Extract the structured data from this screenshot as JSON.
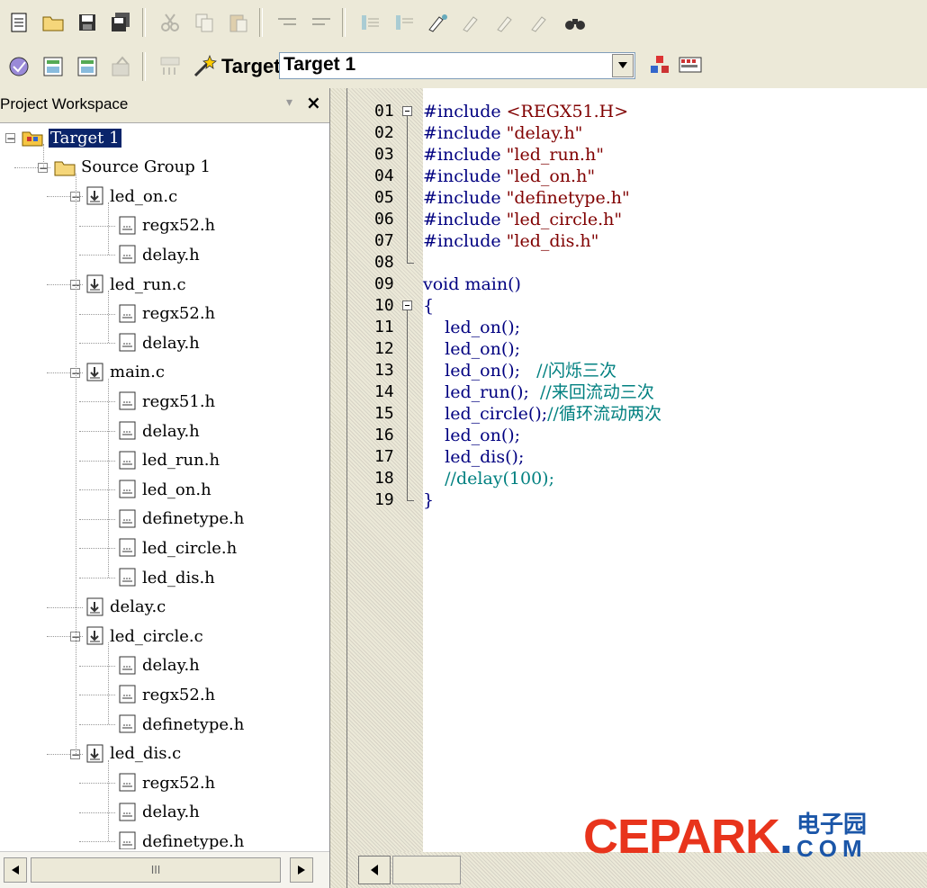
{
  "toolbar2": {
    "target_name": "Target 1"
  },
  "workspace": {
    "title": "Project Workspace",
    "pin": "▾",
    "close": "×",
    "scroll_thumb_label": "III"
  },
  "tree": [
    {
      "label": "Target 1",
      "depth": 0,
      "icon": "target-icon",
      "expanded": true,
      "selected": true
    },
    {
      "label": "Source Group 1",
      "depth": 1,
      "icon": "folder-icon",
      "expanded": true
    },
    {
      "label": "led_on.c",
      "depth": 2,
      "icon": "c-file-icon",
      "expanded": true
    },
    {
      "label": "regx52.h",
      "depth": 3,
      "icon": "h-file-icon"
    },
    {
      "label": "delay.h",
      "depth": 3,
      "icon": "h-file-icon"
    },
    {
      "label": "led_run.c",
      "depth": 2,
      "icon": "c-file-icon",
      "expanded": true
    },
    {
      "label": "regx52.h",
      "depth": 3,
      "icon": "h-file-icon"
    },
    {
      "label": "delay.h",
      "depth": 3,
      "icon": "h-file-icon"
    },
    {
      "label": "main.c",
      "depth": 2,
      "icon": "c-file-icon",
      "expanded": true
    },
    {
      "label": "regx51.h",
      "depth": 3,
      "icon": "h-file-icon"
    },
    {
      "label": "delay.h",
      "depth": 3,
      "icon": "h-file-icon"
    },
    {
      "label": "led_run.h",
      "depth": 3,
      "icon": "h-file-icon"
    },
    {
      "label": "led_on.h",
      "depth": 3,
      "icon": "h-file-icon"
    },
    {
      "label": "definetype.h",
      "depth": 3,
      "icon": "h-file-icon"
    },
    {
      "label": "led_circle.h",
      "depth": 3,
      "icon": "h-file-icon"
    },
    {
      "label": "led_dis.h",
      "depth": 3,
      "icon": "h-file-icon"
    },
    {
      "label": "delay.c",
      "depth": 2,
      "icon": "c-file-icon"
    },
    {
      "label": "led_circle.c",
      "depth": 2,
      "icon": "c-file-icon",
      "expanded": true
    },
    {
      "label": "delay.h",
      "depth": 3,
      "icon": "h-file-icon"
    },
    {
      "label": "regx52.h",
      "depth": 3,
      "icon": "h-file-icon"
    },
    {
      "label": "definetype.h",
      "depth": 3,
      "icon": "h-file-icon"
    },
    {
      "label": "led_dis.c",
      "depth": 2,
      "icon": "c-file-icon",
      "expanded": true
    },
    {
      "label": "regx52.h",
      "depth": 3,
      "icon": "h-file-icon"
    },
    {
      "label": "delay.h",
      "depth": 3,
      "icon": "h-file-icon"
    },
    {
      "label": "definetype.h",
      "depth": 3,
      "icon": "h-file-icon"
    }
  ],
  "editor": {
    "lines": [
      {
        "num": "01",
        "fold": true,
        "tokens": [
          {
            "t": "#include ",
            "c": "kw"
          },
          {
            "t": "<REGX51.H>",
            "c": "str"
          }
        ]
      },
      {
        "num": "02",
        "tokens": [
          {
            "t": "#include ",
            "c": "kw"
          },
          {
            "t": "\"delay.h\"",
            "c": "str"
          }
        ]
      },
      {
        "num": "03",
        "tokens": [
          {
            "t": "#include ",
            "c": "kw"
          },
          {
            "t": "\"led_run.h\"",
            "c": "str"
          }
        ]
      },
      {
        "num": "04",
        "tokens": [
          {
            "t": "#include ",
            "c": "kw"
          },
          {
            "t": "\"led_on.h\"",
            "c": "str"
          }
        ]
      },
      {
        "num": "05",
        "tokens": [
          {
            "t": "#include ",
            "c": "kw"
          },
          {
            "t": "\"definetype.h\"",
            "c": "str"
          }
        ]
      },
      {
        "num": "06",
        "tokens": [
          {
            "t": "#include ",
            "c": "kw"
          },
          {
            "t": "\"led_circle.h\"",
            "c": "str"
          }
        ]
      },
      {
        "num": "07",
        "tokens": [
          {
            "t": "#include ",
            "c": "kw"
          },
          {
            "t": "\"led_dis.h\"",
            "c": "str"
          }
        ]
      },
      {
        "num": "08",
        "tokens": []
      },
      {
        "num": "09",
        "tokens": [
          {
            "t": "void main()",
            "c": "kw"
          }
        ]
      },
      {
        "num": "10",
        "fold": true,
        "tokens": [
          {
            "t": "{",
            "c": "kw"
          }
        ]
      },
      {
        "num": "11",
        "tokens": [
          {
            "t": "    led_on();",
            "c": "kw"
          }
        ]
      },
      {
        "num": "12",
        "tokens": [
          {
            "t": "    led_on();",
            "c": "kw"
          }
        ]
      },
      {
        "num": "13",
        "tokens": [
          {
            "t": "    led_on();   ",
            "c": "kw"
          },
          {
            "t": "//闪烁三次",
            "c": "cm"
          }
        ]
      },
      {
        "num": "14",
        "tokens": [
          {
            "t": "    led_run();  ",
            "c": "kw"
          },
          {
            "t": "//来回流动三次",
            "c": "cm"
          }
        ]
      },
      {
        "num": "15",
        "tokens": [
          {
            "t": "    led_circle();",
            "c": "kw"
          },
          {
            "t": "//循环流动两次",
            "c": "cm"
          }
        ]
      },
      {
        "num": "16",
        "tokens": [
          {
            "t": "    led_on();",
            "c": "kw"
          }
        ]
      },
      {
        "num": "17",
        "tokens": [
          {
            "t": "    led_dis();",
            "c": "kw"
          }
        ]
      },
      {
        "num": "18",
        "tokens": [
          {
            "t": "    //delay(100);",
            "c": "cm"
          }
        ]
      },
      {
        "num": "19",
        "tokens": [
          {
            "t": "}",
            "c": "kw"
          }
        ]
      }
    ]
  },
  "watermark": {
    "brand": "CEPARK",
    "dot": ".",
    "cn": "电子园",
    "com": "COM"
  },
  "colors": {
    "keyword": "#000080",
    "string": "#800000",
    "comment": "#008080",
    "selection": "#0a246a",
    "brand_red": "#e8341c",
    "brand_blue": "#1b56a8"
  }
}
